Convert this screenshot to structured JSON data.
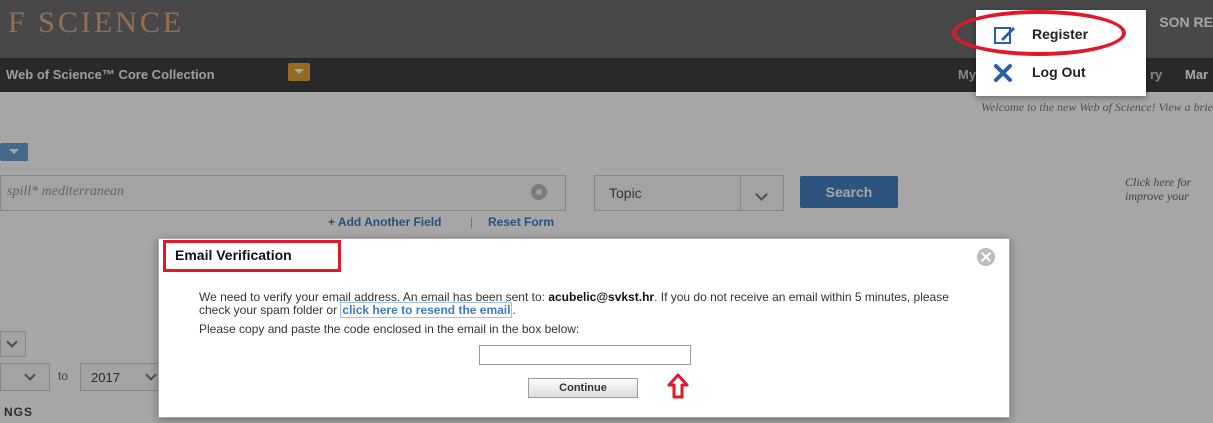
{
  "header": {
    "brand": "F SCIENCE",
    "right_text": "SON RE"
  },
  "nav": {
    "collection_label": "Web of Science™ Core Collection",
    "right_items": [
      "My",
      "ry",
      "Mar"
    ]
  },
  "welcome_text": "Welcome to the new Web of Science! View a brie",
  "search": {
    "query_text": "spill* mediterranean",
    "field_select": "Topic",
    "search_button": "Search",
    "add_field": "+ Add Another Field",
    "separator": "|",
    "reset_form": "Reset Form",
    "help_text_line1": "Click here for",
    "help_text_line2": "improve your"
  },
  "timespan": {
    "to_label": "to",
    "end_year": "2017"
  },
  "settings_label": "NGS",
  "account_menu": {
    "register_label": "Register",
    "logout_label": "Log Out"
  },
  "dialog": {
    "title": "Email Verification",
    "body_part1": "We need to verify your email address. An email has been sent to: ",
    "email": "acubelic@svkst.hr",
    "body_part2": ". If you do not receive an email within 5 minutes, please check your spam folder or ",
    "resend_link": "click here to resend the email",
    "body_part3": ".",
    "instruction": "Please copy and paste the code enclosed in the email in the box below:",
    "code_value": "",
    "continue_button": "Continue"
  },
  "colors": {
    "annotation_red": "#e01828",
    "link_blue": "#3c7bc2",
    "search_button": "#4682c4"
  }
}
